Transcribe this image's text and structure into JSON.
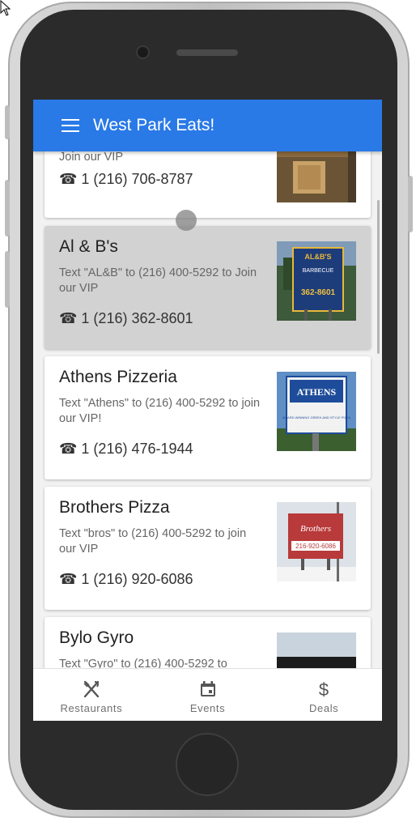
{
  "app": {
    "title": "West Park Eats!"
  },
  "restaurants": [
    {
      "name": "",
      "text": "Join our VIP",
      "phone": "☎ 1 (216) 706-8787"
    },
    {
      "name": "Al & B's",
      "text": "Text \"AL&B\" to (216) 400-5292 to Join our VIP",
      "phone": "☎ 1 (216) 362-8601",
      "thumb_text": [
        "AL&B'S",
        "BARBECUE",
        "362-8601"
      ]
    },
    {
      "name": "Athens Pizzeria",
      "text": "Text \"Athens\" to (216) 400-5292 to join our VIP!",
      "phone": "☎ 1 (216) 476-1944",
      "thumb_text": [
        "ATHENS",
        "AWARD WINNING GREEK AND STYLE PIZZA"
      ]
    },
    {
      "name": "Brothers Pizza",
      "text": "Text \"bros\" to (216) 400-5292 to join our VIP",
      "phone": "☎ 1 (216) 920-6086",
      "thumb_text": [
        "Brothers",
        "216-920-6086"
      ]
    },
    {
      "name": "Bylo Gyro",
      "text": "Text \"Gyro\" to (216) 400-5292 to",
      "phone": ""
    }
  ],
  "bottom_nav": [
    {
      "label": "Restaurants",
      "icon": "fork-knife-icon"
    },
    {
      "label": "Events",
      "icon": "calendar-icon"
    },
    {
      "label": "Deals",
      "icon": "dollar-icon"
    }
  ],
  "colors": {
    "app_bar": "#2979e6",
    "pressed_card": "#d2d2d2",
    "screen_bg": "#f2f2f2"
  }
}
